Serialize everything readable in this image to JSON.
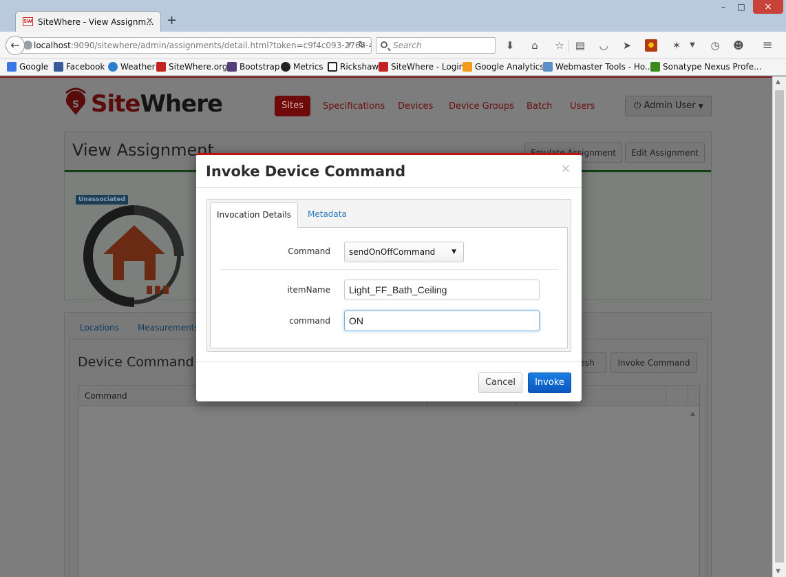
{
  "browser": {
    "tab_title": "SiteWhere - View Assignm...",
    "tab_favicon": "SW",
    "tab_close": "×",
    "new_tab": "+",
    "url_host": "localhost",
    "url_rest": ":9090/sitewhere/admin/assignments/detail.html?token=c9f4c093-2766-4",
    "search_placeholder": "Search",
    "window_min": "–",
    "window_max": "□",
    "window_close": "×",
    "bookmarks": [
      {
        "label": "Google",
        "color": "#3b78e7"
      },
      {
        "label": "Facebook",
        "color": "#3b5998"
      },
      {
        "label": "Weather",
        "color": "#2b7fd1"
      },
      {
        "label": "SiteWhere.org",
        "color": "#c22222"
      },
      {
        "label": "Bootstrap",
        "color": "#563d7c"
      },
      {
        "label": "Metrics",
        "color": "#222222"
      },
      {
        "label": "Rickshaw",
        "color": "#222222"
      },
      {
        "label": "SiteWhere - Login",
        "color": "#c22222"
      },
      {
        "label": "Google Analytics",
        "color": "#f39a1b"
      },
      {
        "label": "Webmaster Tools - Ho...",
        "color": "#5b8fc7"
      },
      {
        "label": "Sonatype Nexus Profe...",
        "color": "#3a8a1e"
      }
    ]
  },
  "app": {
    "logo_site": "Site",
    "logo_where": "Where",
    "nav": [
      "Sites",
      "Specifications",
      "Devices",
      "Device Groups",
      "Batch",
      "Users"
    ],
    "user_menu": "Admin User",
    "view_title": "View Assignment",
    "emulate_button": "Emulate Assignment",
    "edit_button": "Edit Assignment",
    "status_badge": "Unassociated",
    "tabs": [
      "Locations",
      "Measurements"
    ],
    "invocations_title": "Device Command Invocations",
    "refresh_button": "Refresh",
    "invoke_command_button": "Invoke Command",
    "grid_columns": [
      "Command"
    ]
  },
  "modal": {
    "title": "Invoke Device Command",
    "close": "×",
    "tabs": {
      "details": "Invocation Details",
      "metadata": "Metadata"
    },
    "command_label": "Command",
    "command_value": "sendOnOffCommand",
    "item_name_label": "itemName",
    "item_name_value": "Light_FF_Bath_Ceiling",
    "command_param_label": "command",
    "command_param_value": "ON",
    "cancel": "Cancel",
    "invoke": "Invoke"
  },
  "colors": {
    "accent_red": "#c2120f",
    "primary_blue": "#0a56bf",
    "link_blue": "#2e7bbf"
  },
  "icons": [
    "back-icon",
    "globe-icon",
    "reload-icon",
    "search-icon",
    "download-icon",
    "home-icon",
    "star-icon",
    "reader-icon",
    "pocket-icon",
    "send-icon",
    "power-icon",
    "caret-down-icon",
    "close-icon"
  ]
}
